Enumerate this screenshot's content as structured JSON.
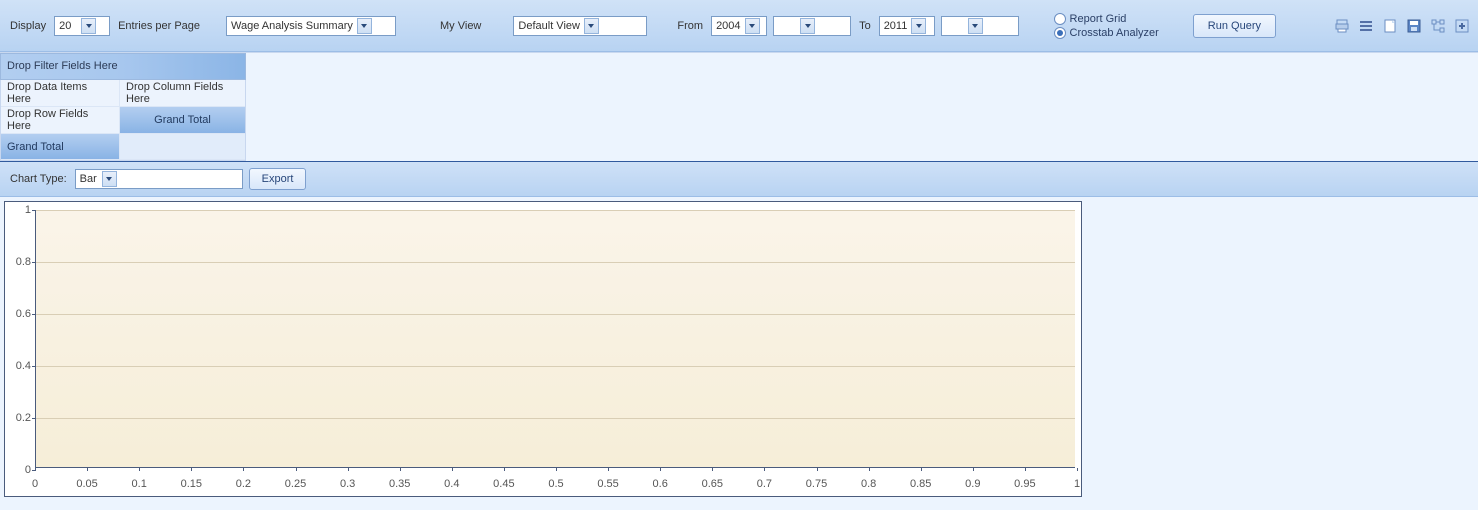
{
  "toolbar": {
    "display_label": "Display",
    "entries_per_page_label": "Entries per Page",
    "page_size": "20",
    "report_select": "Wage Analysis Summary",
    "my_view_label": "My View",
    "view_select": "Default View",
    "from_label": "From",
    "from_year": "2004",
    "from_extra": "",
    "to_label": "To",
    "to_year": "2011",
    "to_extra": "",
    "radio_report_grid": "Report Grid",
    "radio_crosstab": "Crosstab Analyzer",
    "run_query": "Run Query"
  },
  "pivot": {
    "filter_label": "Drop Filter Fields Here",
    "data_label": "Drop Data Items Here",
    "column_label": "Drop Column Fields Here",
    "row_label": "Drop Row Fields Here",
    "grand_total": "Grand Total"
  },
  "chart_bar": {
    "chart_type_label": "Chart Type:",
    "chart_type_value": "Bar",
    "export_label": "Export"
  },
  "chart_data": {
    "type": "bar",
    "categories": [],
    "values": [],
    "title": "",
    "xlabel": "",
    "ylabel": "",
    "xlim": [
      0,
      1
    ],
    "ylim": [
      0,
      1
    ],
    "xticks": [
      "0",
      "0.05",
      "0.1",
      "0.15",
      "0.2",
      "0.25",
      "0.3",
      "0.35",
      "0.4",
      "0.45",
      "0.5",
      "0.55",
      "0.6",
      "0.65",
      "0.7",
      "0.75",
      "0.8",
      "0.85",
      "0.9",
      "0.95",
      "1"
    ],
    "yticks": [
      "0",
      "0.2",
      "0.4",
      "0.6",
      "0.8",
      "1"
    ]
  }
}
